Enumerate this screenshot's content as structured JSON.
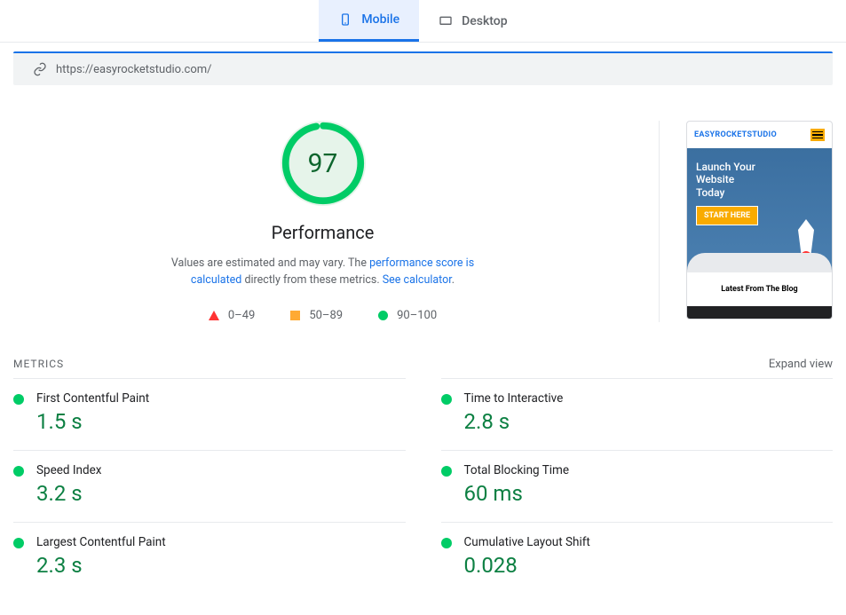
{
  "tabs": {
    "mobile": "Mobile",
    "desktop": "Desktop"
  },
  "url": "https://easyrocketstudio.com/",
  "performance": {
    "score": "97",
    "title": "Performance",
    "desc_prefix": "Values are estimated and may vary. The ",
    "desc_link1": "performance score is calculated",
    "desc_mid": " directly from these metrics. ",
    "desc_link2": "See calculator",
    "desc_suffix": "."
  },
  "legend": {
    "low": "0–49",
    "mid": "50–89",
    "high": "90–100"
  },
  "preview": {
    "logo": "EASYROCKETSTUDIO",
    "hero_line1": "Launch Your",
    "hero_line2": "Website",
    "hero_line3": "Today",
    "cta": "START HERE",
    "blog": "Latest From The Blog"
  },
  "metrics_header": {
    "title": "METRICS",
    "expand": "Expand view"
  },
  "metrics": [
    {
      "name": "First Contentful Paint",
      "value": "1.5 s",
      "status": "good"
    },
    {
      "name": "Time to Interactive",
      "value": "2.8 s",
      "status": "good"
    },
    {
      "name": "Speed Index",
      "value": "3.2 s",
      "status": "good"
    },
    {
      "name": "Total Blocking Time",
      "value": "60 ms",
      "status": "good"
    },
    {
      "name": "Largest Contentful Paint",
      "value": "2.3 s",
      "status": "good"
    },
    {
      "name": "Cumulative Layout Shift",
      "value": "0.028",
      "status": "good"
    }
  ],
  "colors": {
    "good": "#0c6",
    "warn": "#fa3",
    "bad": "#f33",
    "accent": "#1a73e8"
  }
}
